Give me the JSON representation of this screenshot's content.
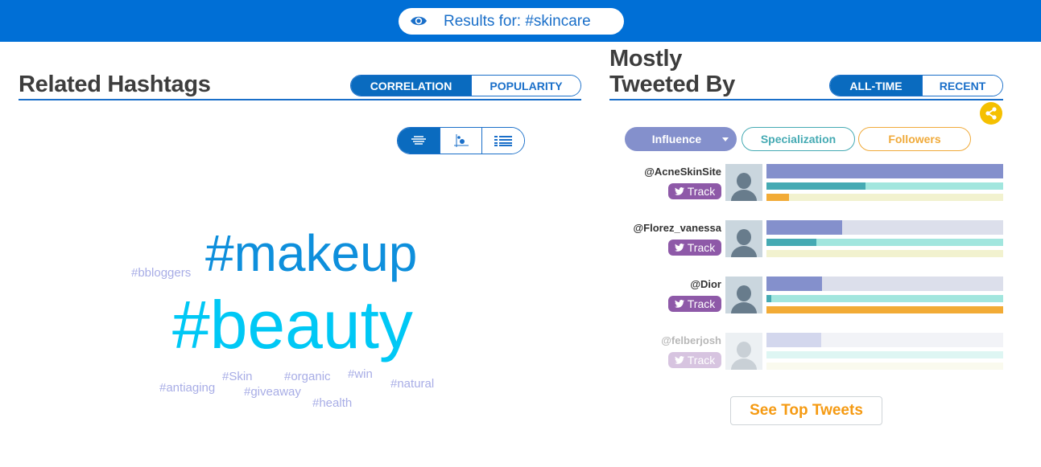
{
  "header": {
    "results_label": "Results for: #skincare",
    "eye_icon": "eye-icon"
  },
  "related_hashtags": {
    "title": "Related Hashtags",
    "mode_tabs": [
      {
        "label": "CORRELATION",
        "active": true
      },
      {
        "label": "POPULARITY",
        "active": false
      }
    ],
    "view_options": [
      {
        "icon": "cloud-view-icon",
        "active": true
      },
      {
        "icon": "scatter-view-icon",
        "active": false
      },
      {
        "icon": "list-view-icon",
        "active": false
      }
    ],
    "cloud_words": [
      {
        "text": "#makeup",
        "color": "#0e8fdc"
      },
      {
        "text": "#beauty",
        "color": "#00c8f5"
      },
      {
        "text": "#bbloggers",
        "color": "#a8ade6"
      },
      {
        "text": "#Skin",
        "color": "#a8ade6"
      },
      {
        "text": "#organic",
        "color": "#a8ade6"
      },
      {
        "text": "#win",
        "color": "#a8ade6"
      },
      {
        "text": "#antiaging",
        "color": "#a8ade6"
      },
      {
        "text": "#giveaway",
        "color": "#a8ade6"
      },
      {
        "text": "#natural",
        "color": "#a8ade6"
      },
      {
        "text": "#health",
        "color": "#a8ade6"
      }
    ]
  },
  "mostly_tweeted_by": {
    "title_line1": "Mostly",
    "title_line2": "Tweeted By",
    "time_tabs": [
      {
        "label": "ALL-TIME",
        "active": true
      },
      {
        "label": "RECENT",
        "active": false
      }
    ],
    "share_icon": "share-icon",
    "metrics": [
      {
        "label": "Influence",
        "active": true,
        "color": "#8490cc"
      },
      {
        "label": "Specialization",
        "active": false,
        "color": "#45aab3"
      },
      {
        "label": "Followers",
        "active": false,
        "color": "#f0aa3a"
      }
    ],
    "track_label": "Track",
    "users": [
      {
        "handle": "@AcneSkinSite",
        "influence_pct": 100,
        "specialization_pct": 42,
        "followers_pct": 9.5,
        "faded": false
      },
      {
        "handle": "@Florez_vanessa",
        "influence_pct": 32,
        "specialization_pct": 21,
        "followers_pct": 0,
        "faded": false
      },
      {
        "handle": "@Dior",
        "influence_pct": 23.5,
        "specialization_pct": 2,
        "followers_pct": 100,
        "faded": false
      },
      {
        "handle": "@felberjosh",
        "influence_pct": 23,
        "specialization_pct": 0,
        "followers_pct": 0,
        "faded": true
      }
    ],
    "see_top_tweets_label": "See Top Tweets"
  }
}
